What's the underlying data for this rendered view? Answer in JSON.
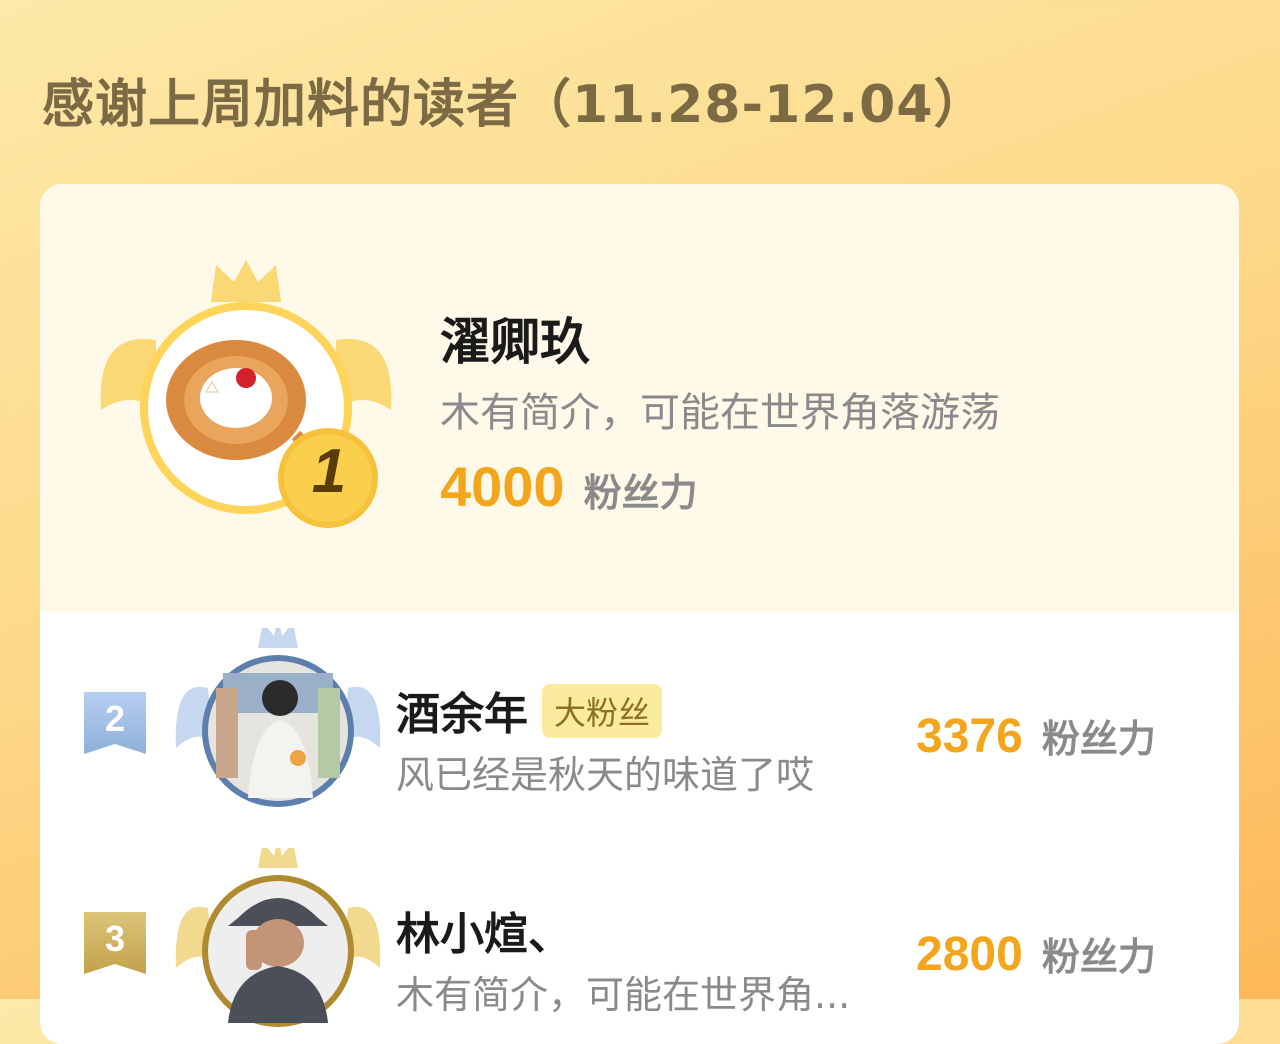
{
  "title": "感谢上周加料的读者（11.28-12.04）",
  "score_unit": "粉丝力",
  "colors": {
    "accent": "#f3a51c",
    "gold": "#f6c23b",
    "silver_blue": "#a9c3e2",
    "bronze": "#cfb25e",
    "title_text": "#7b6a44"
  },
  "top_reader": {
    "rank": "1",
    "name": "濯卿玖",
    "bio": "木有简介，可能在世界角落游荡",
    "score": "4000",
    "avatar_icon": "cat-pastry-avatar-icon"
  },
  "readers": [
    {
      "rank": "2",
      "name": "酒余年",
      "badge": "大粉丝",
      "bio": "风已经是秋天的味道了哎",
      "score": "3376",
      "avatar_icon": "person-avatar-icon"
    },
    {
      "rank": "3",
      "name": "林小煊、",
      "bio": "木有简介，可能在世界角...",
      "score": "2800",
      "avatar_icon": "person-hat-avatar-icon"
    }
  ]
}
